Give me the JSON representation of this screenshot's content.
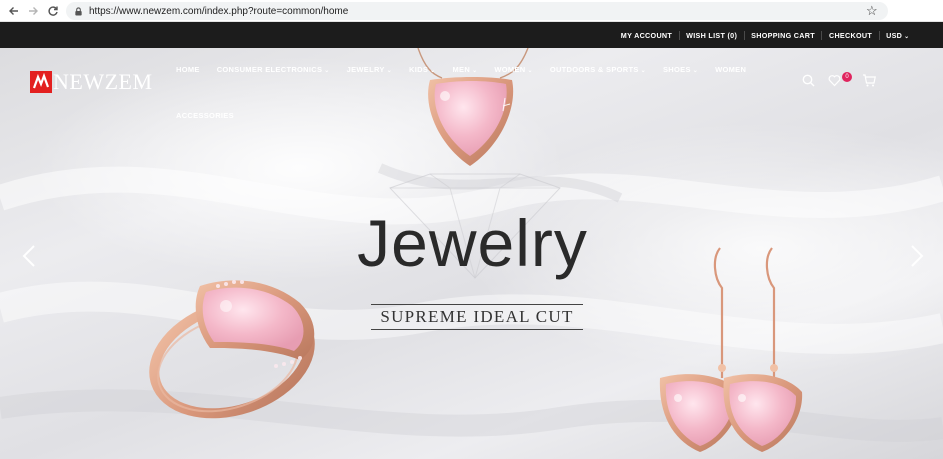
{
  "browser": {
    "url": "https://www.newzem.com/index.php?route=common/home",
    "back_icon": "arrow-left-icon",
    "forward_icon": "arrow-right-icon",
    "reload_icon": "reload-icon",
    "bookmark_icon": "star-icon"
  },
  "topbar": {
    "links": [
      "MY ACCOUNT",
      "WISH LIST (0)",
      "SHOPPING CART",
      "CHECKOUT",
      "USD"
    ]
  },
  "header": {
    "logo_text": "NEWZEM",
    "nav": [
      "HOME",
      "CONSUMER ELECTRONICS",
      "JEWELRY",
      "KIDS",
      "MEN",
      "WOMEN",
      "OUTDOORS & SPORTS",
      "SHOES",
      "WOMEN"
    ],
    "nav_row2": [
      "ACCESSORIES"
    ],
    "cart_count": "0"
  },
  "hero": {
    "title": "Jewelry",
    "subtitle": "SUPREME IDEAL CUT"
  },
  "colors": {
    "topbar_bg": "#1c1c1c",
    "logo_red": "#e32020",
    "badge": "#e0245e",
    "rose_gold": "#d9a087",
    "pink_stone": "#f4b8c9"
  }
}
